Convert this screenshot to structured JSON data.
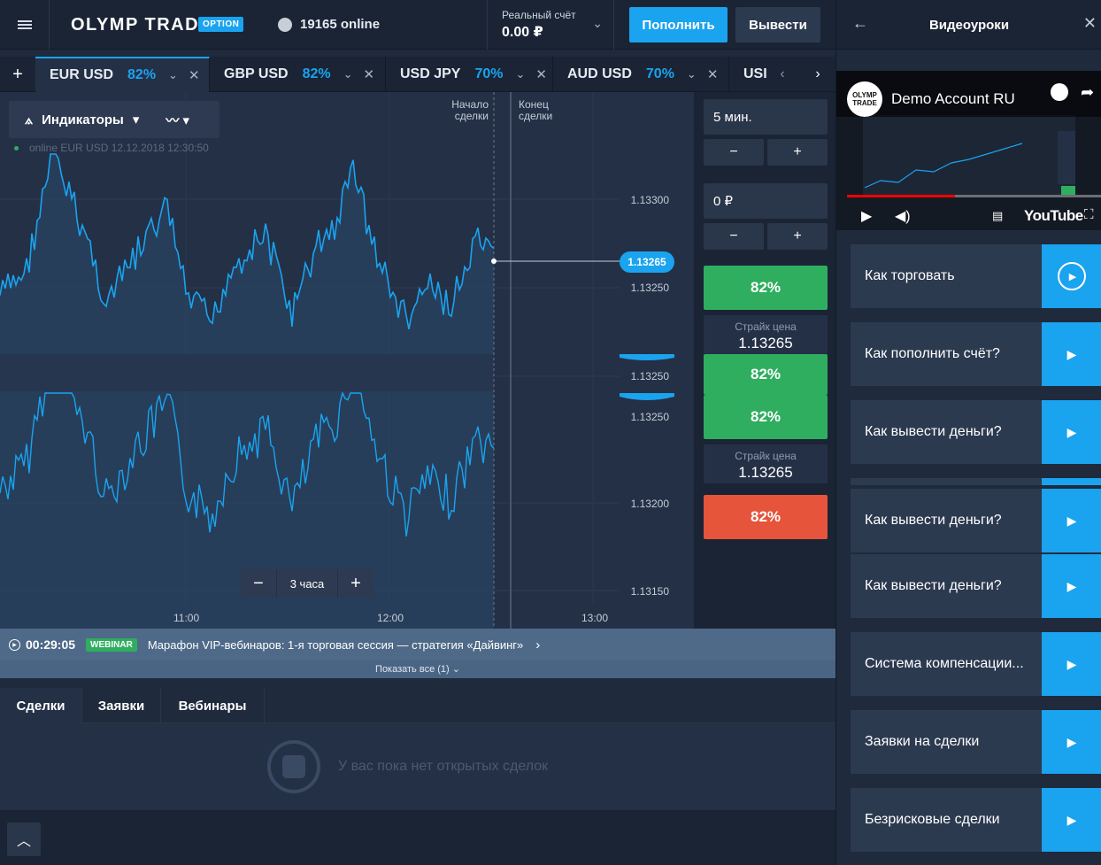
{
  "header": {
    "logo": "OLYMP TRADE",
    "logo_badge": "OPTION",
    "online": "19165 online",
    "account_label": "Реальный счёт",
    "account_value": "0.00 ₽",
    "deposit": "Пополнить",
    "withdraw": "Вывести"
  },
  "tabs": [
    {
      "name": "EUR USD",
      "pct": "82%"
    },
    {
      "name": "GBP USD",
      "pct": "82%"
    },
    {
      "name": "USD JPY",
      "pct": "70%"
    },
    {
      "name": "AUD USD",
      "pct": "70%"
    },
    {
      "name": "USI",
      "pct": ""
    }
  ],
  "chart": {
    "indicators": "Индикаторы",
    "info": "online EUR USD  12.12.2018 12:30:50",
    "start_label": "Начало сделки",
    "end_label": "Конец сделки",
    "current_price": "1.13265",
    "y_labels": [
      "1.13300",
      "1.13250",
      "1.13250",
      "1.13250",
      "1.13200",
      "1.13150"
    ],
    "x_labels": [
      "11:00",
      "12:00",
      "13:00"
    ],
    "zoom_label": "3 часа"
  },
  "panel": {
    "time": "5 мин.",
    "amount": "0 ₽",
    "minus": "−",
    "plus": "+",
    "up_pct": "82%",
    "strike_label": "Страйк цена",
    "strike_value": "1.13265",
    "up_pct_2": "82%",
    "up_pct_3": "82%",
    "strike_label_2": "Страйк цена",
    "strike_value_2": "1.13265",
    "down_pct": "82%"
  },
  "webinar": {
    "time": "00:29:05",
    "badge": "WEBINAR",
    "text": "Марафон VIP-вебинаров: 1-я торговая сессия — стратегия «Дайвинг»",
    "show_all": "Показать все (1)"
  },
  "bottom": {
    "tabs": [
      "Сделки",
      "Заявки",
      "Вебинары"
    ],
    "empty": "У вас пока нет открытых сделок"
  },
  "sidebar": {
    "title": "Видеоуроки",
    "video_logo": "OLYMP TRADE",
    "video_title": "Demo Account RU",
    "video_brand": "YouTube",
    "lessons": [
      "Как торговать",
      "Как пополнить счёт?",
      "Как вывести деньги?",
      "Как вывести деньги?",
      "Как вывести деньги?",
      "Система компенсации...",
      "Заявки на сделки",
      "Безрисковые сделки"
    ]
  },
  "colors": {
    "accent": "#1aa3ef",
    "up": "#2fae60",
    "down": "#e5543b"
  }
}
